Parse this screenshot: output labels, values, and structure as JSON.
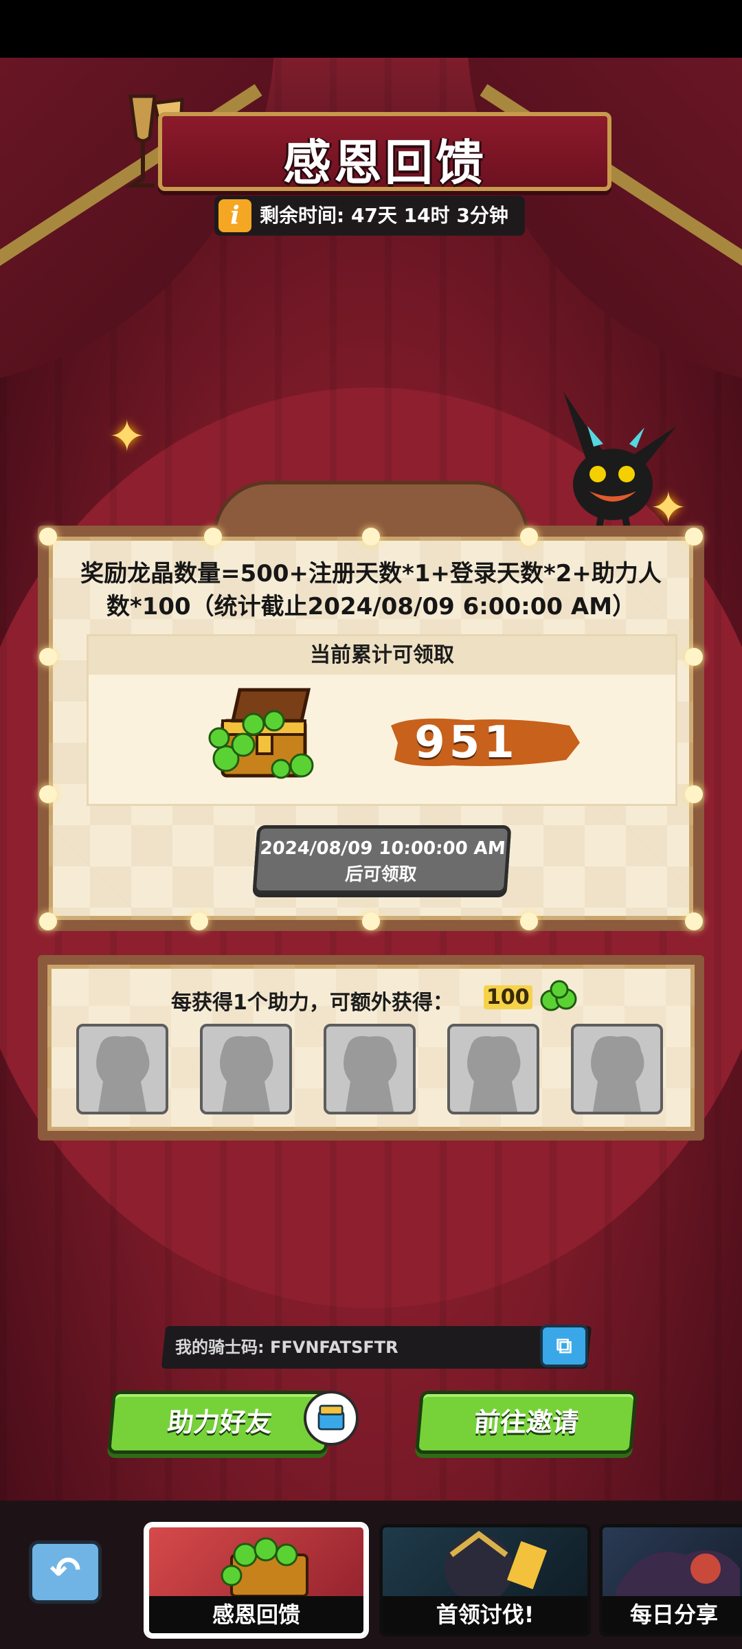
{
  "header": {
    "title": "感恩回馈",
    "timer_label": "剩余时间: 47天 14时 3分钟"
  },
  "reward": {
    "formula": "奖励龙晶数量=500+注册天数*1+登录天数*2+助力人数*100（统计截止2024/08/09 6:00:00 AM）",
    "panel_title": "当前累计可领取",
    "amount": "951",
    "claim_text": "2024/08/09 10:00:00 AM后可领取"
  },
  "helper": {
    "title": "每获得1个助力，可额外获得：",
    "bonus": "100"
  },
  "code": {
    "label": "我的骑士码: FFVNFATSFTR"
  },
  "actions": {
    "help_friend": "助力好友",
    "invite": "前往邀请"
  },
  "tabs": [
    "感恩回馈",
    "首领讨伐!",
    "每日分享"
  ],
  "colors": {
    "accent_green": "#77d23a",
    "accent_gold": "#c79a4c",
    "amount_brush": "#c8611b"
  }
}
